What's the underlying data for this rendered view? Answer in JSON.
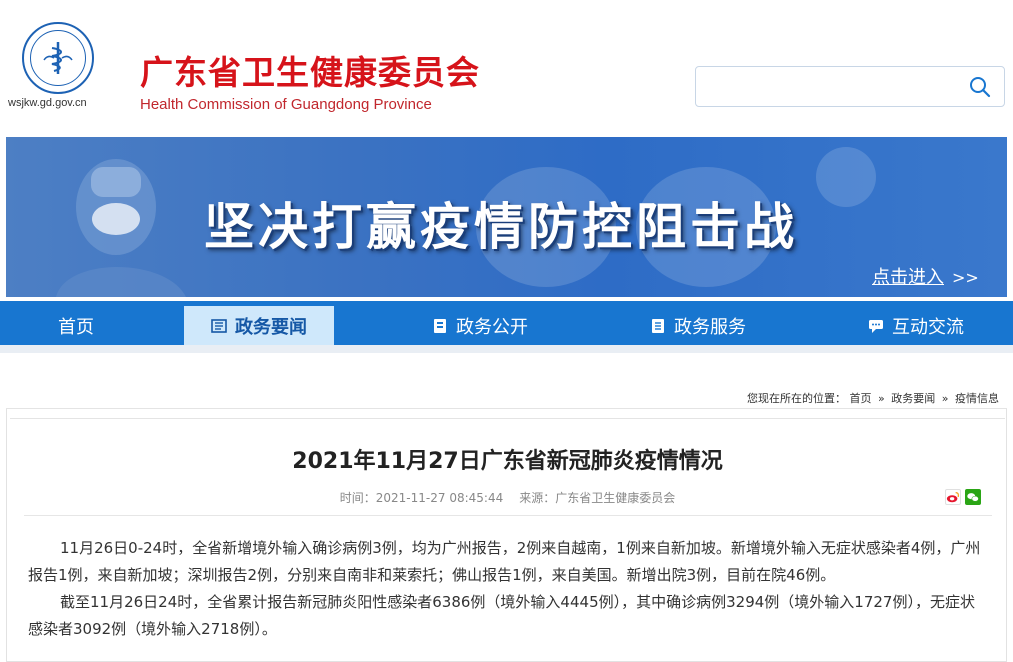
{
  "header": {
    "domain": "wsjkw.gd.gov.cn",
    "title": "广东省卫生健康委员会",
    "subtitle": "Health Commission of Guangdong Province",
    "search_placeholder": ""
  },
  "banner": {
    "slogan": "坚决打赢疫情防控阻击战",
    "enter_label": "点击进入",
    "enter_arrow": ">>"
  },
  "nav": {
    "items": [
      {
        "label": "首页",
        "icon": ""
      },
      {
        "label": "政务要闻",
        "icon": "news-icon",
        "active": true
      },
      {
        "label": "政务公开",
        "icon": "book-icon"
      },
      {
        "label": "政务服务",
        "icon": "document-icon"
      },
      {
        "label": "互动交流",
        "icon": "chat-icon"
      }
    ]
  },
  "breadcrumb": {
    "prefix": "您现在所在的位置：",
    "items": [
      "首页",
      "政务要闻",
      "疫情信息"
    ],
    "sep": "»"
  },
  "article": {
    "title": "2021年11月27日广东省新冠肺炎疫情情况",
    "time_label": "时间：",
    "time_value": "2021-11-27 08:45:44",
    "source_label": "来源：",
    "source_value": "广东省卫生健康委员会",
    "paragraphs": [
      "11月26日0-24时，全省新增境外输入确诊病例3例，均为广州报告，2例来自越南，1例来自新加坡。新增境外输入无症状感染者4例，广州报告1例，来自新加坡；深圳报告2例，分别来自南非和莱索托；佛山报告1例，来自美国。新增出院3例，目前在院46例。",
      "截至11月26日24时，全省累计报告新冠肺炎阳性感染者6386例（境外输入4445例），其中确诊病例3294例（境外输入1727例），无症状感染者3092例（境外输入2718例）。"
    ]
  },
  "share": {
    "icons": [
      "weibo-icon",
      "wechat-icon"
    ]
  },
  "colors": {
    "title_red": "#d6131a",
    "nav_blue": "#1876d0",
    "nav_active_bg": "#cfe8fb",
    "banner_blue": "#3b72c2"
  }
}
